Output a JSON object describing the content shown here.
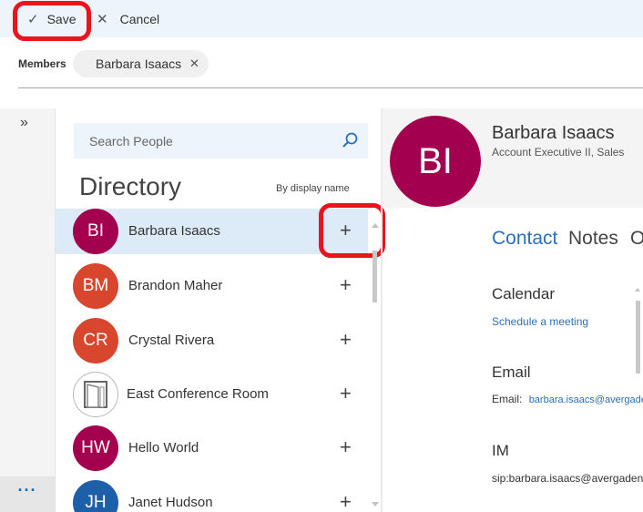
{
  "toolbar": {
    "save_label": "Save",
    "cancel_label": "Cancel"
  },
  "members": {
    "label": "Members",
    "chips": [
      {
        "name": "Barbara Isaacs"
      }
    ]
  },
  "rail": {
    "expand_glyph": "»",
    "more_glyph": "···"
  },
  "search": {
    "placeholder": "Search People"
  },
  "directory": {
    "title": "Directory",
    "sort_label": "By display name",
    "people": [
      {
        "initials": "BI",
        "name": "Barbara Isaacs",
        "color": "#a3004f",
        "selected": true
      },
      {
        "initials": "BM",
        "name": "Brandon Maher",
        "color": "#d8462d"
      },
      {
        "initials": "CR",
        "name": "Crystal Rivera",
        "color": "#d8462d"
      },
      {
        "initials": "",
        "name": "East Conference Room",
        "color": "#ffffff",
        "icon": "room-icon"
      },
      {
        "initials": "HW",
        "name": "Hello World",
        "color": "#a3004f"
      },
      {
        "initials": "JH",
        "name": "Janet Hudson",
        "color": "#1d5fa8"
      }
    ],
    "add_glyph": "+"
  },
  "contact": {
    "initials": "BI",
    "avatar_color": "#a3004f",
    "name": "Barbara Isaacs",
    "title": "Account Executive II, Sales",
    "tabs": [
      "Contact",
      "Notes",
      "Organization"
    ],
    "calendar": {
      "heading": "Calendar",
      "link": "Schedule a meeting"
    },
    "email": {
      "heading": "Email",
      "label": "Email:",
      "value": "barbara.isaacs@avergadent.com"
    },
    "im": {
      "heading": "IM",
      "value": "sip:barbara.isaacs@avergadent.com"
    }
  },
  "colors": {
    "accent": "#2a70b8",
    "highlight": "#e8151f",
    "selected_row": "#dcebf7"
  }
}
